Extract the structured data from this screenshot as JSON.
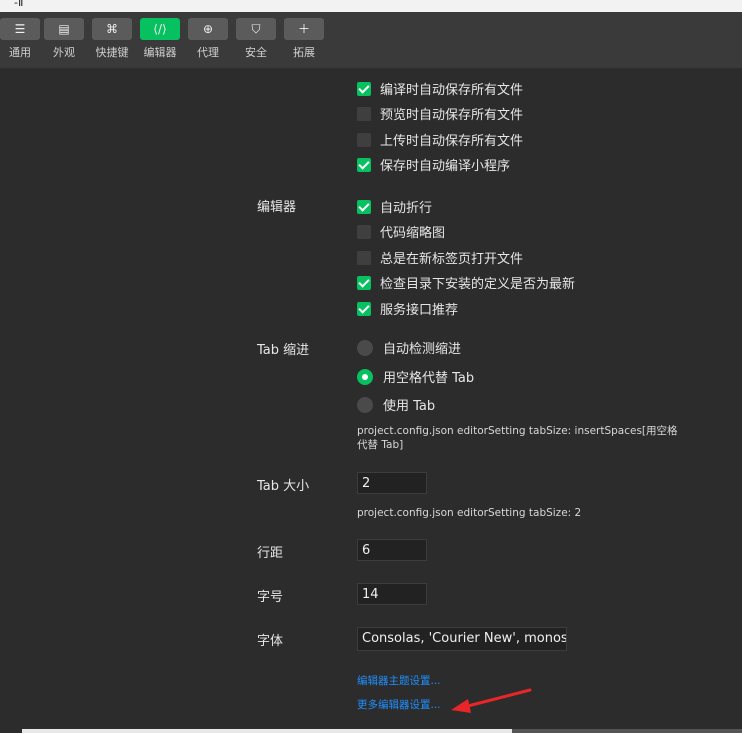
{
  "window": {
    "title_fragment": "-Ⅱ"
  },
  "toolbar": {
    "items": [
      {
        "label": "通用",
        "icon": "list-icon",
        "glyph": "☰"
      },
      {
        "label": "外观",
        "icon": "window-icon",
        "glyph": "▤"
      },
      {
        "label": "快捷键",
        "icon": "command-icon",
        "glyph": "⌘"
      },
      {
        "label": "编辑器",
        "icon": "code-icon",
        "glyph": "⟨/⟩",
        "active": true
      },
      {
        "label": "代理",
        "icon": "globe-icon",
        "glyph": "⊕"
      },
      {
        "label": "安全",
        "icon": "shield-icon",
        "glyph": "⛉"
      },
      {
        "label": "拓展",
        "icon": "plus-icon",
        "glyph": "＋"
      }
    ],
    "active_color": "#07c160"
  },
  "autosave": [
    {
      "label": "编译时自动保存所有文件",
      "checked": true
    },
    {
      "label": "预览时自动保存所有文件",
      "checked": false
    },
    {
      "label": "上传时自动保存所有文件",
      "checked": false
    },
    {
      "label": "保存时自动编译小程序",
      "checked": true
    }
  ],
  "editor": {
    "label": "编辑器",
    "options": [
      {
        "label": "自动折行",
        "checked": true
      },
      {
        "label": "代码缩略图",
        "checked": false
      },
      {
        "label": "总是在新标签页打开文件",
        "checked": false
      },
      {
        "label": "检查目录下安装的定义是否为最新",
        "checked": true
      },
      {
        "label": "服务接口推荐",
        "checked": true
      }
    ]
  },
  "tab_indent": {
    "label": "Tab 缩进",
    "options": [
      {
        "label": "自动检测缩进",
        "selected": false
      },
      {
        "label": "用空格代替 Tab",
        "selected": true
      },
      {
        "label": "使用 Tab",
        "selected": false
      }
    ],
    "hint": "project.config.json editorSetting tabSize: insertSpaces[用空格代替 Tab]"
  },
  "tab_size": {
    "label": "Tab 大小",
    "value": "2",
    "hint": "project.config.json editorSetting tabSize: 2"
  },
  "line_height": {
    "label": "行距",
    "value": "6"
  },
  "font_size": {
    "label": "字号",
    "value": "14"
  },
  "font_family": {
    "label": "字体",
    "value": "Consolas, 'Courier New', monos"
  },
  "links": {
    "theme": "编辑器主题设置...",
    "more": "更多编辑器设置..."
  },
  "annotation": {
    "arrow_color": "#e8262a"
  }
}
